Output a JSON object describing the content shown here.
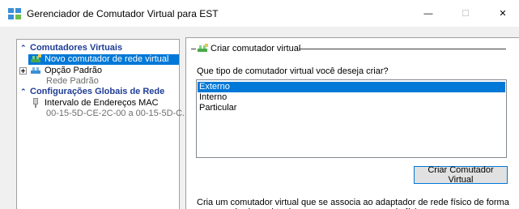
{
  "window": {
    "title": "Gerenciador de Comutador Virtual para EST",
    "minimize_glyph": "—",
    "maximize_glyph": "☐",
    "close_glyph": "✕"
  },
  "tree": {
    "sections": [
      {
        "label": "Comutadores Virtuais",
        "chevron": "⌃",
        "items": [
          {
            "label": "Novo comutador de rede virtual",
            "icon": "new-switch-icon",
            "selected": true
          },
          {
            "label": "Opção Padrão",
            "icon": "network-switch-icon",
            "sublabel": "Rede Padrão",
            "expandable": true
          }
        ]
      },
      {
        "label": "Configurações Globais de Rede",
        "chevron": "⌃",
        "items": [
          {
            "label": "Intervalo de Endereços MAC",
            "icon": "mac-range-icon",
            "sublabel": "00-15-5D-CE-2C-00 a 00-15-5D-C..."
          }
        ]
      }
    ]
  },
  "panel": {
    "group_title": "Criar comutador virtual",
    "question": "Que tipo de comutador virtual você deseja criar?",
    "switch_types": [
      {
        "label": "Externo",
        "selected": true
      },
      {
        "label": "Interno",
        "selected": false
      },
      {
        "label": "Particular",
        "selected": false
      }
    ],
    "create_button": "Criar Comutador Virtual",
    "description": "Cria um comutador virtual que se associa ao adaptador de rede físico de forma que as máquinas virtuais possam acessar uma rede física."
  },
  "colors": {
    "accent": "#0078d7",
    "section_header": "#1e3c96",
    "subtext": "#6d6d6d"
  }
}
